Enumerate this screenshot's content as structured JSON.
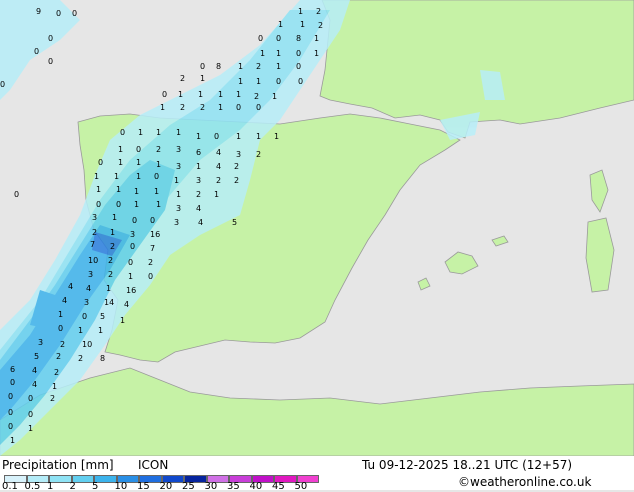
{
  "footer": {
    "title": "Precipitation [mm]",
    "model": "ICON",
    "datetime": "Tu 09-12-2025 18..21 UTC (12+57)",
    "credit": "©weatheronline.co.uk"
  },
  "legend": {
    "ticks": [
      "0.1",
      "0.5",
      "1",
      "2",
      "5",
      "10",
      "15",
      "20",
      "25",
      "30",
      "35",
      "40",
      "45",
      "50"
    ],
    "colors": [
      "#d8f2fb",
      "#b4ecf8",
      "#8fe3f5",
      "#62cff0",
      "#3cb3ec",
      "#2a8fe6",
      "#1f6ee0",
      "#1048cc",
      "#06249e",
      "#d070e6",
      "#c83ed8",
      "#c010c8",
      "#e018c0",
      "#f040d0"
    ]
  },
  "colors": {
    "sea": "#e6e6e6",
    "land": "#c6f2a6",
    "rain_light": "#b7eef8",
    "rain_mid": "#62cff0",
    "rain_heavy": "#2a7fe0"
  },
  "map_numbers": [
    "9",
    "0",
    "0",
    "0",
    "0",
    "0",
    "1",
    "2",
    "1",
    "1",
    "2",
    "0",
    "0",
    "8",
    "1",
    "1",
    "1",
    "0",
    "1",
    "1",
    "2",
    "1",
    "0",
    "0",
    "8",
    "2",
    "1",
    "1",
    "1",
    "0",
    "0",
    "0",
    "1",
    "1",
    "1",
    "1",
    "2",
    "1",
    "1",
    "2",
    "2",
    "1",
    "0",
    "0",
    "0",
    "1",
    "1",
    "1",
    "1",
    "0",
    "1",
    "1",
    "1",
    "1",
    "0",
    "2",
    "3",
    "6",
    "4",
    "3",
    "2",
    "0",
    "1",
    "1",
    "1",
    "3",
    "1",
    "4",
    "2",
    "1",
    "1",
    "1",
    "0",
    "1",
    "3",
    "2",
    "2",
    "1",
    "1",
    "1",
    "1",
    "1",
    "2",
    "1",
    "0",
    "0",
    "1",
    "1",
    "3",
    "4",
    "3",
    "1",
    "0",
    "0",
    "3",
    "4",
    "5",
    "2",
    "1",
    "3",
    "16",
    "7",
    "2",
    "0",
    "7",
    "10",
    "2",
    "0",
    "2",
    "3",
    "2",
    "1",
    "0",
    "4",
    "4",
    "1",
    "16",
    "4",
    "3",
    "14",
    "4",
    "1",
    "0",
    "5",
    "1",
    "0",
    "1",
    "1",
    "3",
    "2",
    "10",
    "5",
    "2",
    "2",
    "8",
    "6",
    "4",
    "2",
    "0",
    "4",
    "1",
    "0",
    "0",
    "2",
    "0",
    "0",
    "0",
    "1",
    "1",
    "0",
    "0",
    "0",
    "0",
    "1",
    "2",
    "8",
    "0"
  ]
}
